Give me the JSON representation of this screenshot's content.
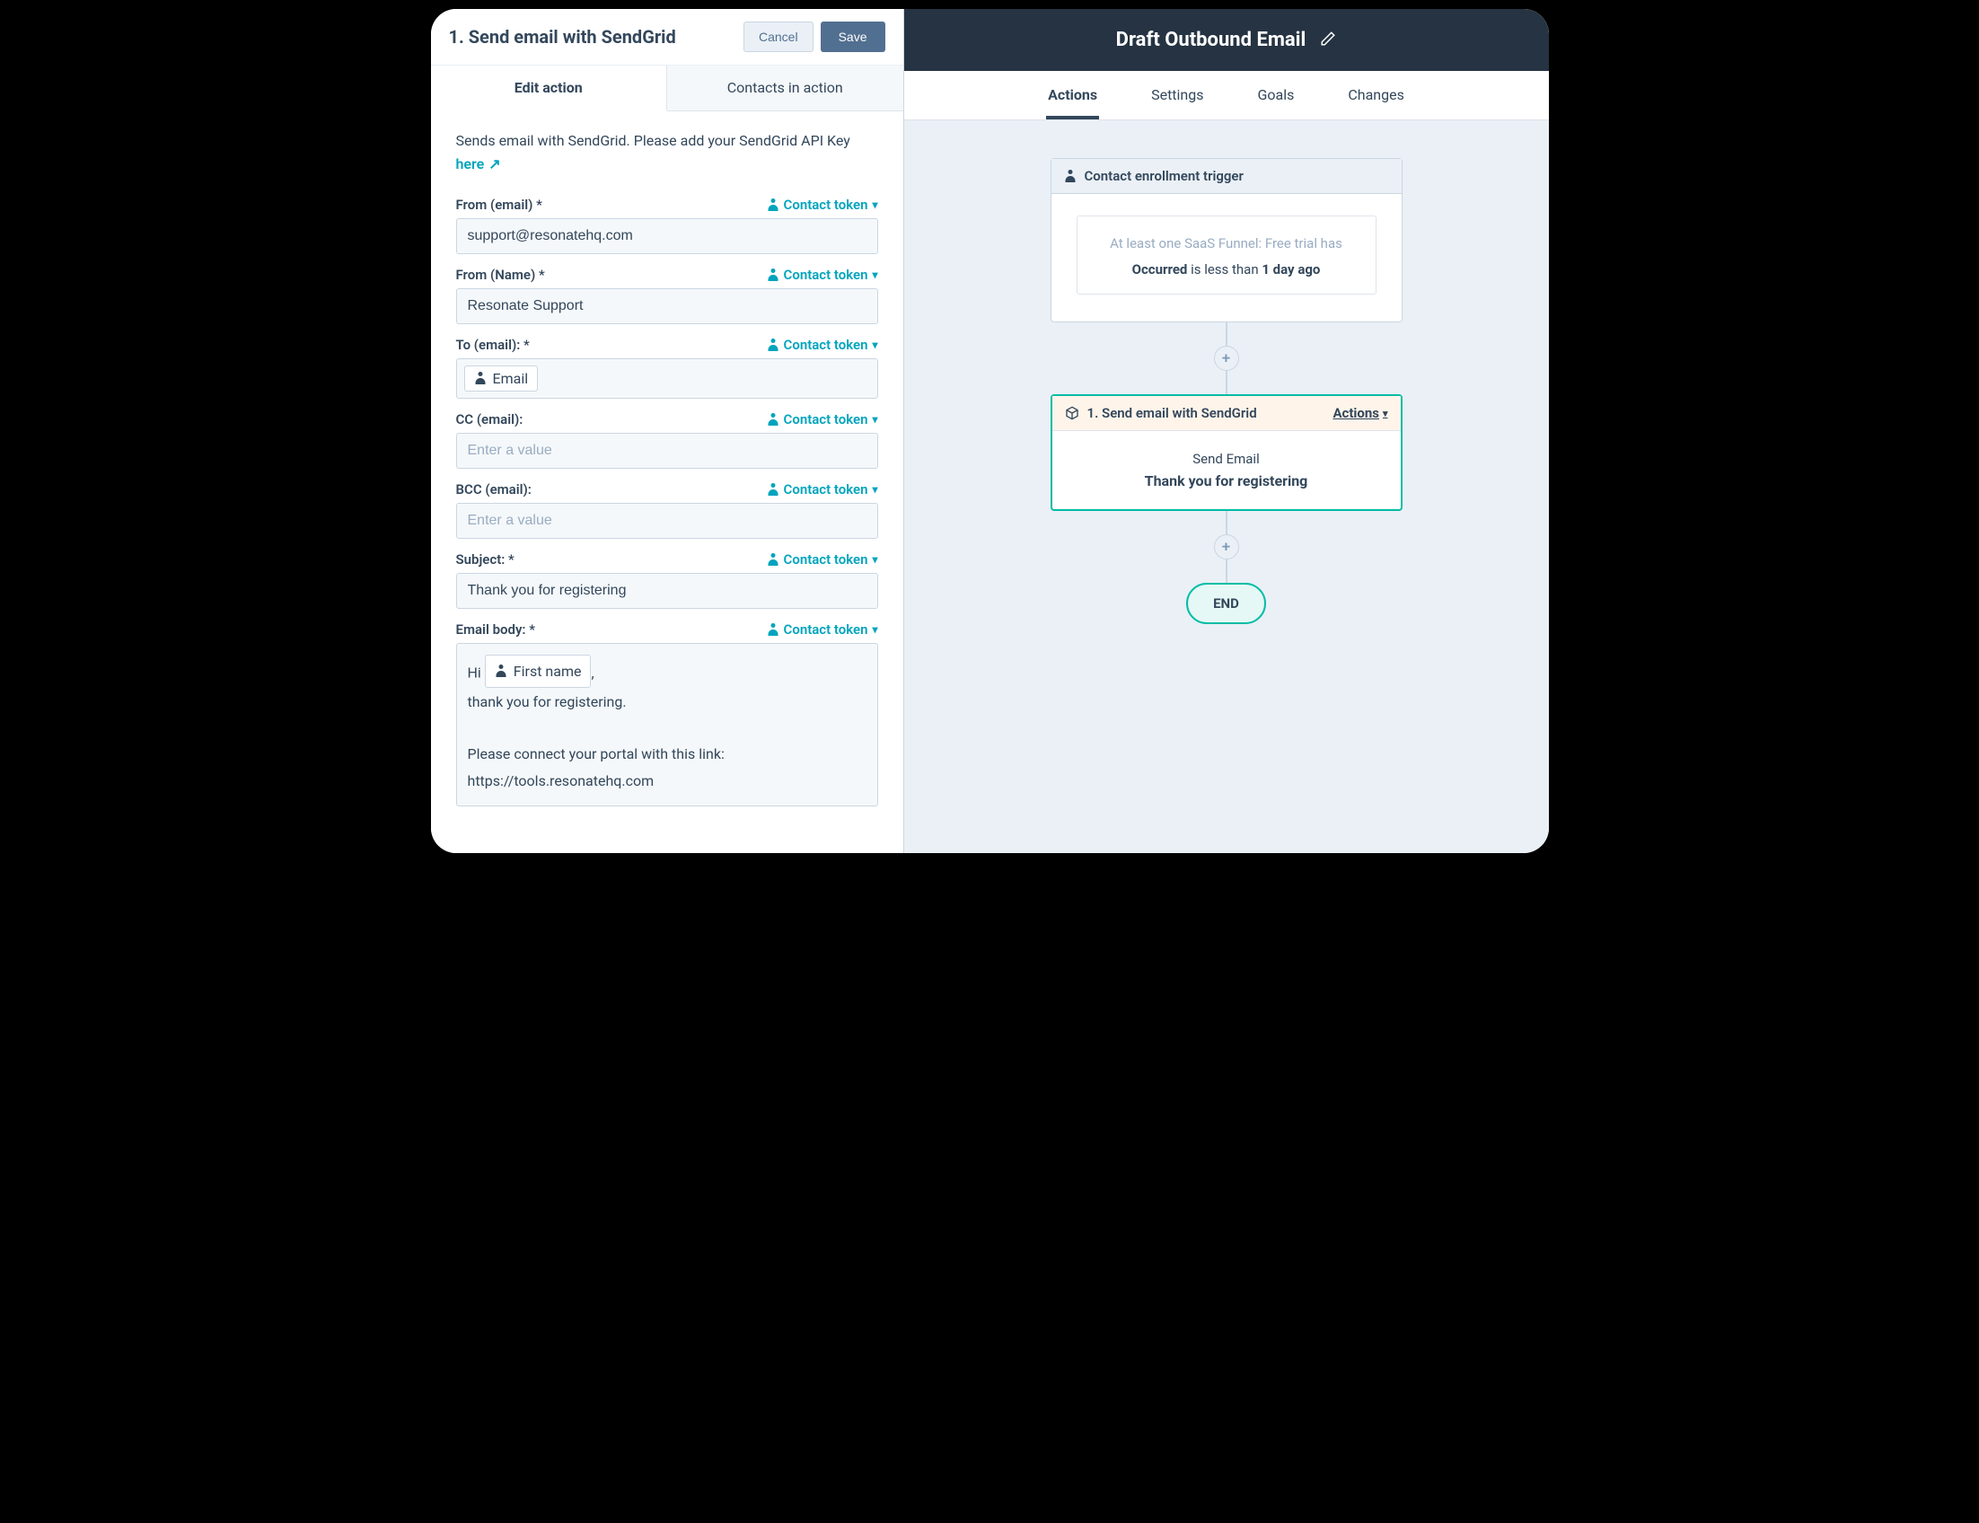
{
  "left": {
    "title": "1. Send email with SendGrid",
    "cancel": "Cancel",
    "save": "Save",
    "tabs": {
      "edit": "Edit action",
      "contacts": "Contacts in action"
    },
    "description": "Sends email with SendGrid. Please add your SendGrid API Key ",
    "here": "here",
    "contact_token": "Contact token",
    "fields": {
      "from_email": {
        "label": "From (email) *",
        "value": "support@resonatehq.com"
      },
      "from_name": {
        "label": "From (Name) *",
        "value": "Resonate Support"
      },
      "to_email": {
        "label": "To (email): *",
        "chip": "Email"
      },
      "cc_email": {
        "label": "CC (email):",
        "placeholder": "Enter a value"
      },
      "bcc_email": {
        "label": "BCC (email):",
        "placeholder": "Enter a value"
      },
      "subject": {
        "label": "Subject: *",
        "value": "Thank you for registering"
      },
      "body": {
        "label": "Email body: *",
        "greeting_prefix": "Hi ",
        "chip": "First name",
        "greeting_suffix": ",",
        "line2": "thank you for registering.",
        "line3": "Please connect your portal with this link:",
        "line4": "https://tools.resonatehq.com"
      }
    }
  },
  "right": {
    "title": "Draft Outbound Email",
    "subnav": {
      "actions": "Actions",
      "settings": "Settings",
      "goals": "Goals",
      "changes": "Changes"
    },
    "trigger": {
      "header": "Contact enrollment trigger",
      "muted": "At least one SaaS Funnel: Free trial has",
      "occurred": "Occurred",
      "mid": " is less than ",
      "time": "1 day ago"
    },
    "action": {
      "header": "1. Send email with SendGrid",
      "actions_label": "Actions",
      "sub": "Send Email",
      "main": "Thank you for registering"
    },
    "end": "END"
  }
}
